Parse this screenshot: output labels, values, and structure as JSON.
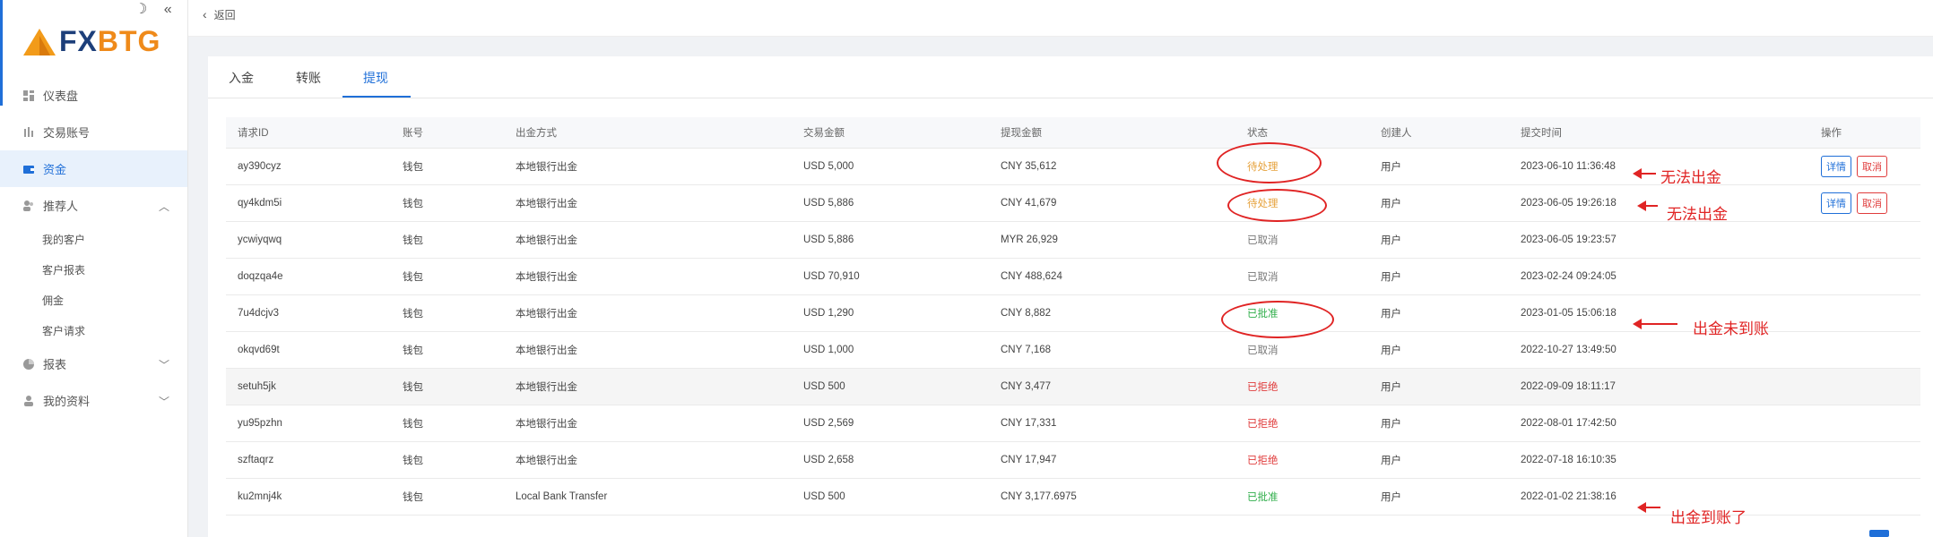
{
  "sidebar": {
    "logo_fx": "FX",
    "logo_btg": "BTG",
    "items": [
      {
        "label": "仪表盘",
        "icon": "dashboard-icon"
      },
      {
        "label": "交易账号",
        "icon": "trading-account-icon"
      },
      {
        "label": "资金",
        "icon": "wallet-icon"
      },
      {
        "label": "推荐人",
        "icon": "referrer-icon"
      },
      {
        "label": "报表",
        "icon": "report-icon"
      },
      {
        "label": "我的资料",
        "icon": "profile-icon"
      }
    ],
    "sub_items": [
      "我的客户",
      "客户报表",
      "佣金",
      "客户请求"
    ]
  },
  "topbar": {
    "back_label": "返回"
  },
  "tabs": [
    "入金",
    "转账",
    "提现"
  ],
  "table": {
    "headers": [
      "请求ID",
      "账号",
      "出金方式",
      "交易金额",
      "提现金额",
      "状态",
      "创建人",
      "提交时间",
      "操作"
    ],
    "rows": [
      {
        "id": "ay390cyz",
        "account": "钱包",
        "method": "本地银行出金",
        "amount": "USD 5,000",
        "withdraw": "CNY 35,612",
        "status": "待处理",
        "creator": "用户",
        "time": "2023-06-10 11:36:48"
      },
      {
        "id": "qy4kdm5i",
        "account": "钱包",
        "method": "本地银行出金",
        "amount": "USD 5,886",
        "withdraw": "CNY 41,679",
        "status": "待处理",
        "creator": "用户",
        "time": "2023-06-05 19:26:18"
      },
      {
        "id": "ycwiyqwq",
        "account": "钱包",
        "method": "本地银行出金",
        "amount": "USD 5,886",
        "withdraw": "MYR 26,929",
        "status": "已取消",
        "creator": "用户",
        "time": "2023-06-05 19:23:57"
      },
      {
        "id": "doqzqa4e",
        "account": "钱包",
        "method": "本地银行出金",
        "amount": "USD 70,910",
        "withdraw": "CNY 488,624",
        "status": "已取消",
        "creator": "用户",
        "time": "2023-02-24 09:24:05"
      },
      {
        "id": "7u4dcjv3",
        "account": "钱包",
        "method": "本地银行出金",
        "amount": "USD 1,290",
        "withdraw": "CNY 8,882",
        "status": "已批准",
        "creator": "用户",
        "time": "2023-01-05 15:06:18"
      },
      {
        "id": "okqvd69t",
        "account": "钱包",
        "method": "本地银行出金",
        "amount": "USD 1,000",
        "withdraw": "CNY 7,168",
        "status": "已取消",
        "creator": "用户",
        "time": "2022-10-27 13:49:50"
      },
      {
        "id": "setuh5jk",
        "account": "钱包",
        "method": "本地银行出金",
        "amount": "USD 500",
        "withdraw": "CNY 3,477",
        "status": "已拒绝",
        "creator": "用户",
        "time": "2022-09-09 18:11:17"
      },
      {
        "id": "yu95pzhn",
        "account": "钱包",
        "method": "本地银行出金",
        "amount": "USD 2,569",
        "withdraw": "CNY 17,331",
        "status": "已拒绝",
        "creator": "用户",
        "time": "2022-08-01 17:42:50"
      },
      {
        "id": "szftaqrz",
        "account": "钱包",
        "method": "本地银行出金",
        "amount": "USD 2,658",
        "withdraw": "CNY 17,947",
        "status": "已拒绝",
        "creator": "用户",
        "time": "2022-07-18 16:10:35"
      },
      {
        "id": "ku2mnj4k",
        "account": "钱包",
        "method": "Local Bank Transfer",
        "amount": "USD 500",
        "withdraw": "CNY 3,177.6975",
        "status": "已批准",
        "creator": "用户",
        "time": "2022-01-02 21:38:16"
      }
    ],
    "action_detail": "详情",
    "action_cancel": "取消"
  },
  "annotations": {
    "note1": "无法出金",
    "note2": "无法出金",
    "note3": "出金未到账",
    "note4": "出金到账了"
  },
  "colors": {
    "accent": "#1f6fd8",
    "annotation": "#e02424",
    "pending": "#e6a23c",
    "approved": "#2fae4a",
    "rejected": "#e03c3c"
  }
}
